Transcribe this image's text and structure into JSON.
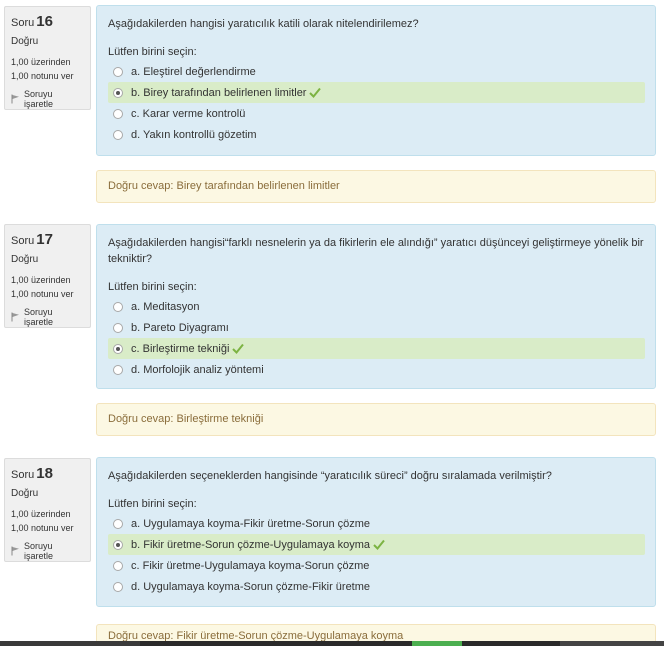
{
  "questions": [
    {
      "label": "Soru",
      "number": "16",
      "state": "Doğru",
      "grade_line1": "1,00 üzerinden",
      "grade_line2": "1,00 notunu ver",
      "flag_label": "Soruyu işaretle",
      "text": "Aşağıdakilerden hangisi yaratıcılık katili olarak nitelendirilemez?",
      "prompt": "Lütfen birini seçin:",
      "options": [
        {
          "label": "a. Eleştirel değerlendirme"
        },
        {
          "label": "b. Birey tarafından belirlenen limitler"
        },
        {
          "label": "c. Karar verme kontrolü"
        },
        {
          "label": "d. Yakın kontrollü gözetim"
        }
      ],
      "feedback": "Doğru cevap: Birey tarafından belirlenen limitler"
    },
    {
      "label": "Soru",
      "number": "17",
      "state": "Doğru",
      "grade_line1": "1,00 üzerinden",
      "grade_line2": "1,00 notunu ver",
      "flag_label": "Soruyu işaretle",
      "text": "Aşağıdakilerden hangisi“farklı nesnelerin ya da fikirlerin ele alındığı” yaratıcı düşünceyi geliştirmeye yönelik bir tekniktir?",
      "prompt": "Lütfen birini seçin:",
      "options": [
        {
          "label": "a. Meditasyon"
        },
        {
          "label": "b. Pareto Diyagramı"
        },
        {
          "label": "c. Birleştirme tekniği"
        },
        {
          "label": "d. Morfolojik analiz yöntemi"
        }
      ],
      "feedback": "Doğru cevap: Birleştirme tekniği"
    },
    {
      "label": "Soru",
      "number": "18",
      "state": "Doğru",
      "grade_line1": "1,00 üzerinden",
      "grade_line2": "1,00 notunu ver",
      "flag_label": "Soruyu işaretle",
      "text": "Aşağıdakilerden seçeneklerden hangisinde “yaratıcılık süreci” doğru sıralamada verilmiştir?",
      "prompt": "Lütfen birini seçin:",
      "options": [
        {
          "label": "a. Uygulamaya koyma-Fikir üretme-Sorun çözme"
        },
        {
          "label": "b. Fikir üretme-Sorun çözme-Uygulamaya koyma"
        },
        {
          "label": "c. Fikir üretme-Uygulamaya koyma-Sorun çözme"
        },
        {
          "label": "d. Uygulamaya koyma-Sorun çözme-Fikir üretme"
        }
      ],
      "feedback": "Doğru cevap: Fikir üretme-Sorun çözme-Uygulamaya koyma"
    }
  ],
  "colors": {
    "question_bg": "#dcecf5",
    "correct_bg": "#d9ecc8",
    "feedback_bg": "#fcf8e3",
    "feedback_text": "#8a6d3b",
    "check": "#7cb342",
    "info_bg": "#f0f0f0"
  },
  "icons": {
    "flag": "flag-icon",
    "correct": "checkmark-icon",
    "radio": "radio-button"
  }
}
